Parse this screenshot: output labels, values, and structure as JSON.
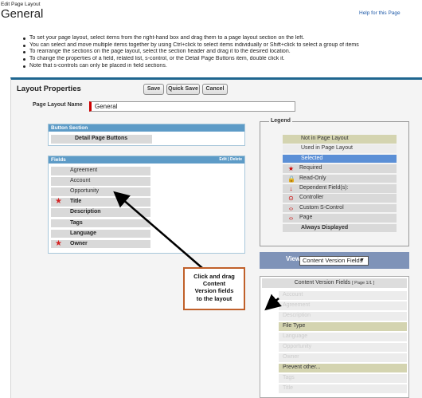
{
  "header": {
    "small_title": "Edit Page Layout",
    "title": "General",
    "help_link": "Help for this Page"
  },
  "instructions": [
    "To set your page layout, select items from the right-hand box and drag them to a page layout section on the left.",
    "You can select and move multiple items together by using Ctrl+click to select items individually or Shift+click to select a group of items",
    "To rearrange the sections on the page layout, select the section header and drag it to the desired location.",
    "To change the properties of a field, related list, s-control, or the Detail Page Buttons item, double click it.",
    "Note that s-controls can only be placed in field sections."
  ],
  "layout_properties": {
    "title": "Layout Properties",
    "save_label": "Save",
    "quick_save_label": "Quick Save",
    "cancel_label": "Cancel",
    "name_label": "Page Layout Name",
    "name_value": "General"
  },
  "button_section": {
    "title": "Button Section",
    "item": "Detail Page Buttons"
  },
  "fields_section": {
    "title": "Fields",
    "links": "Edit | Delete",
    "items": [
      {
        "label": "Agreement",
        "bold": false,
        "required": false
      },
      {
        "label": "Account",
        "bold": false,
        "required": false
      },
      {
        "label": "Opportunity",
        "bold": false,
        "required": false
      },
      {
        "label": "Title",
        "bold": true,
        "required": true
      },
      {
        "label": "Description",
        "bold": true,
        "required": false
      },
      {
        "label": "Tags",
        "bold": true,
        "required": false
      },
      {
        "label": "Language",
        "bold": true,
        "required": false
      },
      {
        "label": "Owner",
        "bold": true,
        "required": true
      }
    ]
  },
  "legend": {
    "title": "Legend",
    "items": [
      {
        "label": "Not in Page Layout",
        "bg": "#d4d4b0",
        "icon": "",
        "icon_name": ""
      },
      {
        "label": "Used in Page Layout",
        "bg": "#ececec",
        "icon": "",
        "icon_name": ""
      },
      {
        "label": "Selected",
        "bg": "#5b8fd6",
        "icon": "",
        "icon_name": ""
      },
      {
        "label": "Required",
        "bg": "#d9d9d9",
        "icon": "★",
        "icon_name": "required-icon"
      },
      {
        "label": "Read-Only",
        "bg": "#d9d9d9",
        "icon": "🔒",
        "icon_name": "lock-icon"
      },
      {
        "label": "Dependent Field(s):",
        "bg": "#d9d9d9",
        "icon": "↓",
        "icon_name": "dependent-arrow-icon"
      },
      {
        "label": "Controller",
        "bg": "#d9d9d9",
        "icon": "⊙",
        "icon_name": "controller-icon"
      },
      {
        "label": "Custom S-Control",
        "bg": "#d9d9d9",
        "icon": "‹›",
        "icon_name": "s-control-icon"
      },
      {
        "label": "Page",
        "bg": "#d9d9d9",
        "icon": "‹›",
        "icon_name": "page-icon"
      },
      {
        "label": "Always Displayed",
        "bg": "#d9d9d9",
        "icon": "",
        "icon_name": "",
        "bold": true
      }
    ]
  },
  "view": {
    "label": "View:",
    "selected": "Content Version Fields"
  },
  "palette": {
    "title": "Content Version Fields",
    "page_info": "[ Page 1/1 ]",
    "items": [
      {
        "label": "Account",
        "state": "used"
      },
      {
        "label": "Agreement",
        "state": "used"
      },
      {
        "label": "Description",
        "state": "used"
      },
      {
        "label": "File Type",
        "state": "not"
      },
      {
        "label": "Language",
        "state": "used"
      },
      {
        "label": "Opportunity",
        "state": "used"
      },
      {
        "label": "Owner",
        "state": "used"
      },
      {
        "label": "Prevent other...",
        "state": "not"
      },
      {
        "label": "Tags",
        "state": "used"
      },
      {
        "label": "Title",
        "state": "used"
      }
    ]
  },
  "callout": {
    "text_lines": [
      "Click and drag",
      "Content",
      "Version fields",
      "to the layout"
    ]
  },
  "colors": {
    "header_blue": "#5d9bc7",
    "panel_border": "#1f6690",
    "callout_border": "#c0602a",
    "required_red": "#d42222"
  }
}
